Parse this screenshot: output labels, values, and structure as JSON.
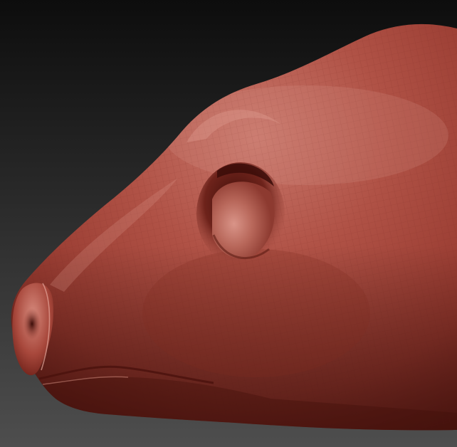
{
  "scene": {
    "subject": "sculpted-animal-head",
    "background": {
      "top_color": "#0d0d0d",
      "bottom_color": "#4e4e4e"
    },
    "material": {
      "base_color": "#a84a3e",
      "highlight_color": "#cf7d70",
      "shadow_color": "#5a1812",
      "wire_color": "#7a2a22"
    }
  }
}
